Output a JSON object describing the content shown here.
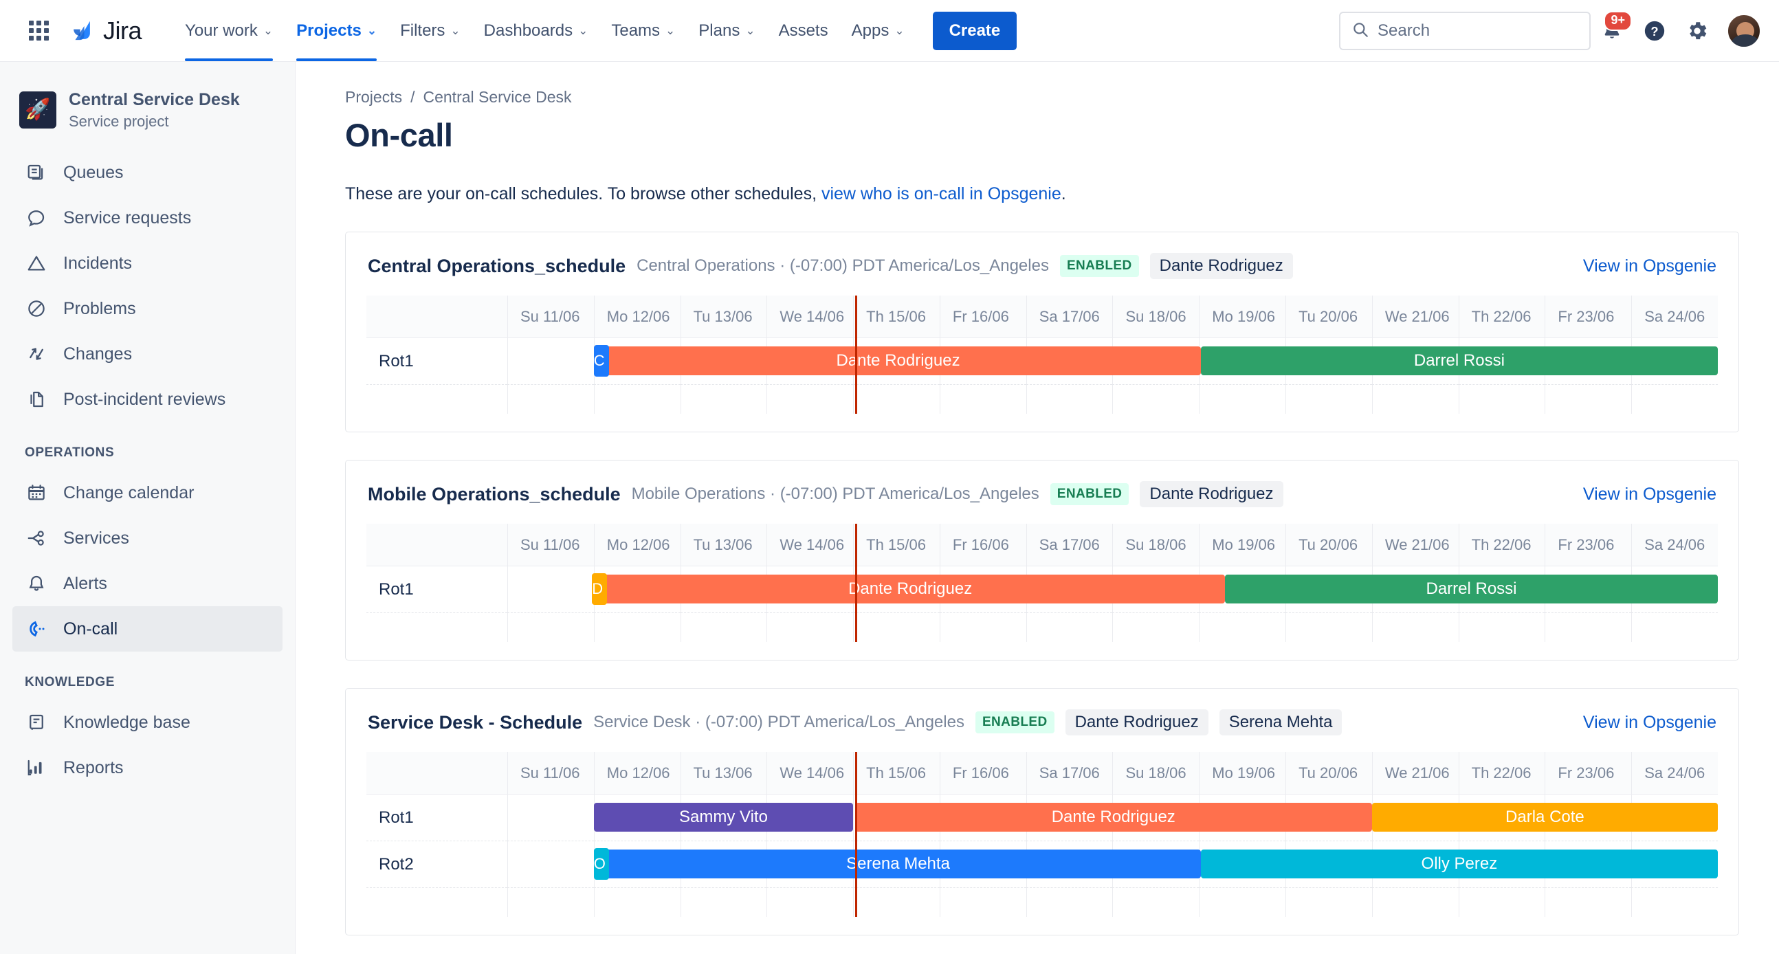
{
  "topnav": {
    "product_name": "Jira",
    "items": [
      {
        "label": "Your work",
        "has_caret": true,
        "active": false
      },
      {
        "label": "Projects",
        "has_caret": true,
        "active": true
      },
      {
        "label": "Filters",
        "has_caret": true,
        "active": false
      },
      {
        "label": "Dashboards",
        "has_caret": true,
        "active": false
      },
      {
        "label": "Teams",
        "has_caret": true,
        "active": false
      },
      {
        "label": "Plans",
        "has_caret": true,
        "active": false
      },
      {
        "label": "Assets",
        "has_caret": false,
        "active": false
      },
      {
        "label": "Apps",
        "has_caret": true,
        "active": false
      }
    ],
    "create_label": "Create",
    "search_placeholder": "Search",
    "notification_badge": "9+",
    "icons": [
      "apps-grid-icon",
      "search-icon",
      "notifications-icon",
      "help-icon",
      "settings-icon",
      "user-avatar"
    ]
  },
  "sidebar": {
    "project_name": "Central Service Desk",
    "project_type": "Service project",
    "items": [
      {
        "label": "Queues",
        "icon": "queues-icon",
        "selected": false
      },
      {
        "label": "Service requests",
        "icon": "speech-bubble-icon",
        "selected": false
      },
      {
        "label": "Incidents",
        "icon": "warning-triangle-icon",
        "selected": false
      },
      {
        "label": "Problems",
        "icon": "no-entry-icon",
        "selected": false
      },
      {
        "label": "Changes",
        "icon": "changes-arrows-icon",
        "selected": false
      },
      {
        "label": "Post-incident reviews",
        "icon": "document-icon",
        "selected": false
      }
    ],
    "operations_title": "OPERATIONS",
    "operations_items": [
      {
        "label": "Change calendar",
        "icon": "calendar-icon",
        "selected": false
      },
      {
        "label": "Services",
        "icon": "services-nodes-icon",
        "selected": false
      },
      {
        "label": "Alerts",
        "icon": "bell-icon",
        "selected": false
      },
      {
        "label": "On-call",
        "icon": "phone-on-call-icon",
        "selected": true
      }
    ],
    "knowledge_title": "KNOWLEDGE",
    "knowledge_items": [
      {
        "label": "Knowledge base",
        "icon": "book-icon",
        "selected": false
      },
      {
        "label": "Reports",
        "icon": "bar-chart-icon",
        "selected": false
      }
    ]
  },
  "main": {
    "breadcrumb": [
      "Projects",
      "Central Service Desk"
    ],
    "breadcrumb_separator": "/",
    "page_title": "On-call",
    "intro_prefix": "These are your on-call schedules. To browse other schedules, ",
    "intro_link": "view who is on-call in Opsgenie",
    "intro_suffix": "."
  },
  "timeline": {
    "days": [
      "Su 11/06",
      "Mo 12/06",
      "Tu 13/06",
      "We 14/06",
      "Th 15/06",
      "Fr 16/06",
      "Sa 17/06",
      "Su 18/06",
      "Mo 19/06",
      "Tu 20/06",
      "We 21/06",
      "Th 22/06",
      "Fr 23/06",
      "Sa 24/06"
    ],
    "now_marker_day_index": 4,
    "now_marker_fraction": 0.02
  },
  "schedules": [
    {
      "name": "Central Operations_schedule",
      "meta": "Central Operations · (-07:00) PDT America/Los_Angeles",
      "status": "ENABLED",
      "people": [
        "Dante Rodriguez"
      ],
      "view_link": "View in Opsgenie",
      "rotations": [
        {
          "label": "Rot1",
          "nub": {
            "letter": "C",
            "color": "#1D7AFC",
            "start": 1.0
          },
          "bars": [
            {
              "name": "Dante Rodriguez",
              "color": "#FF704D",
              "start": 1.02,
              "end": 8.02
            },
            {
              "name": "Darrel Rossi",
              "color": "#2EA169",
              "start": 8.02,
              "end": 14.0
            }
          ]
        }
      ]
    },
    {
      "name": "Mobile Operations_schedule",
      "meta": "Mobile Operations · (-07:00) PDT America/Los_Angeles",
      "status": "ENABLED",
      "people": [
        "Dante Rodriguez"
      ],
      "view_link": "View in Opsgenie",
      "rotations": [
        {
          "label": "Rot1",
          "nub": {
            "letter": "D",
            "color": "#FFAB00",
            "start": 0.98
          },
          "bars": [
            {
              "name": "Dante Rodriguez",
              "color": "#FF704D",
              "start": 1.02,
              "end": 8.3
            },
            {
              "name": "Darrel Rossi",
              "color": "#2EA169",
              "start": 8.3,
              "end": 14.0
            }
          ]
        }
      ]
    },
    {
      "name": "Service Desk - Schedule",
      "meta": "Service Desk · (-07:00) PDT America/Los_Angeles",
      "status": "ENABLED",
      "people": [
        "Dante Rodriguez",
        "Serena Mehta"
      ],
      "view_link": "View in Opsgenie",
      "rotations": [
        {
          "label": "Rot1",
          "nub": null,
          "bars": [
            {
              "name": "Sammy Vito",
              "color": "#5E4DB2",
              "start": 1.0,
              "end": 4.0
            },
            {
              "name": "Dante Rodriguez",
              "color": "#FF704D",
              "start": 4.02,
              "end": 10.0
            },
            {
              "name": "Darla Cote",
              "color": "#FFAB00",
              "start": 10.0,
              "end": 14.0
            }
          ]
        },
        {
          "label": "Rot2",
          "nub": {
            "letter": "O",
            "color": "#00B8D9",
            "start": 1.0
          },
          "bars": [
            {
              "name": "Serena Mehta",
              "color": "#1D7AFC",
              "start": 1.02,
              "end": 8.02
            },
            {
              "name": "Olly Perez",
              "color": "#00B8D9",
              "start": 8.02,
              "end": 14.0
            }
          ]
        }
      ]
    }
  ],
  "colors": {
    "brand_blue": "#0C5BCE",
    "link_blue": "#0C66E4",
    "now_marker_red": "#BF2600",
    "enabled_green_bg": "#DCFFF1",
    "enabled_green_text": "#177D52"
  }
}
